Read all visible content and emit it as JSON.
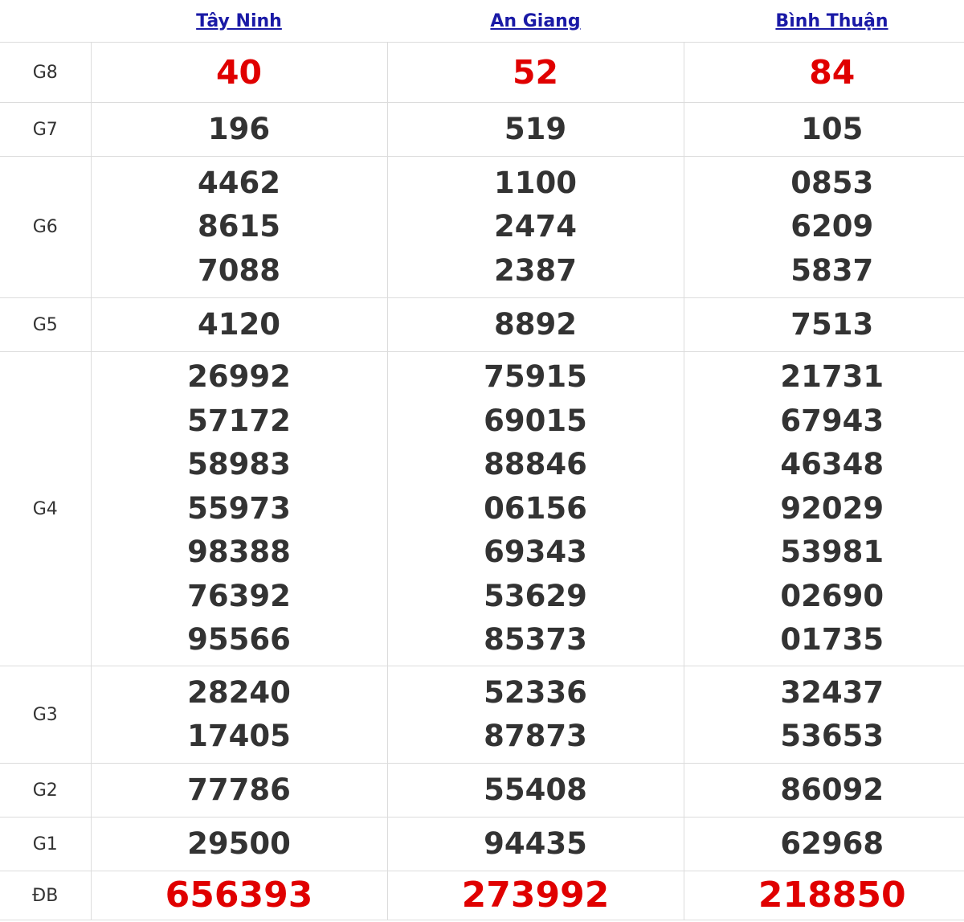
{
  "provinces": [
    "Tây Ninh",
    "An Giang",
    "Bình Thuận"
  ],
  "prizes": [
    {
      "label": "G8",
      "tay_ninh": [
        "40"
      ],
      "an_giang": [
        "52"
      ],
      "binh_thuan": [
        "84"
      ]
    },
    {
      "label": "G7",
      "tay_ninh": [
        "196"
      ],
      "an_giang": [
        "519"
      ],
      "binh_thuan": [
        "105"
      ]
    },
    {
      "label": "G6",
      "tay_ninh": [
        "4462",
        "8615",
        "7088"
      ],
      "an_giang": [
        "1100",
        "2474",
        "2387"
      ],
      "binh_thuan": [
        "0853",
        "6209",
        "5837"
      ]
    },
    {
      "label": "G5",
      "tay_ninh": [
        "4120"
      ],
      "an_giang": [
        "8892"
      ],
      "binh_thuan": [
        "7513"
      ]
    },
    {
      "label": "G4",
      "tay_ninh": [
        "26992",
        "57172",
        "58983",
        "55973",
        "98388",
        "76392",
        "95566"
      ],
      "an_giang": [
        "75915",
        "69015",
        "88846",
        "06156",
        "69343",
        "53629",
        "85373"
      ],
      "binh_thuan": [
        "21731",
        "67943",
        "46348",
        "92029",
        "53981",
        "02690",
        "01735"
      ]
    },
    {
      "label": "G3",
      "tay_ninh": [
        "28240",
        "17405"
      ],
      "an_giang": [
        "52336",
        "87873"
      ],
      "binh_thuan": [
        "32437",
        "53653"
      ]
    },
    {
      "label": "G2",
      "tay_ninh": [
        "77786"
      ],
      "an_giang": [
        "55408"
      ],
      "binh_thuan": [
        "86092"
      ]
    },
    {
      "label": "G1",
      "tay_ninh": [
        "29500"
      ],
      "an_giang": [
        "94435"
      ],
      "binh_thuan": [
        "62968"
      ]
    },
    {
      "label": "ĐB",
      "tay_ninh": [
        "656393"
      ],
      "an_giang": [
        "273992"
      ],
      "binh_thuan": [
        "218850"
      ]
    }
  ],
  "colors": {
    "link": "#1a1aa6",
    "highlight": "#e00000",
    "text": "#333333",
    "border": "#dcdcdc"
  }
}
